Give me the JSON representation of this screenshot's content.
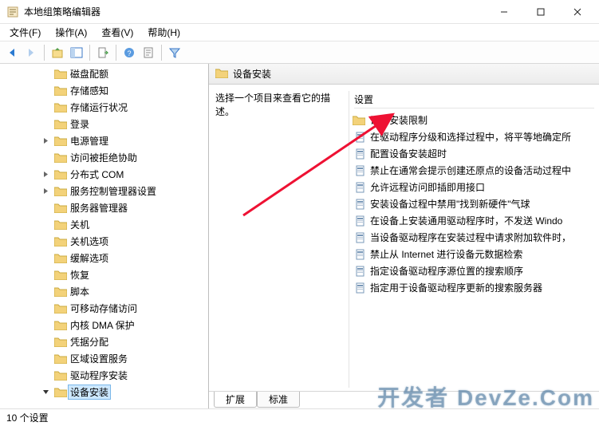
{
  "window": {
    "title": "本地组策略编辑器"
  },
  "menus": [
    "文件(F)",
    "操作(A)",
    "查看(V)",
    "帮助(H)"
  ],
  "tree_items": [
    {
      "label": "磁盘配额",
      "expandable": false
    },
    {
      "label": "存储感知",
      "expandable": false
    },
    {
      "label": "存储运行状况",
      "expandable": false
    },
    {
      "label": "登录",
      "expandable": false
    },
    {
      "label": "电源管理",
      "expandable": true
    },
    {
      "label": "访问被拒绝协助",
      "expandable": false
    },
    {
      "label": "分布式 COM",
      "expandable": true
    },
    {
      "label": "服务控制管理器设置",
      "expandable": true
    },
    {
      "label": "服务器管理器",
      "expandable": false
    },
    {
      "label": "关机",
      "expandable": false
    },
    {
      "label": "关机选项",
      "expandable": false
    },
    {
      "label": "缓解选项",
      "expandable": false
    },
    {
      "label": "恢复",
      "expandable": false
    },
    {
      "label": "脚本",
      "expandable": false
    },
    {
      "label": "可移动存储访问",
      "expandable": false
    },
    {
      "label": "内核 DMA 保护",
      "expandable": false
    },
    {
      "label": "凭据分配",
      "expandable": false
    },
    {
      "label": "区域设置服务",
      "expandable": false
    },
    {
      "label": "驱动程序安装",
      "expandable": false
    },
    {
      "label": "设备安装",
      "expandable": true,
      "selected": true
    }
  ],
  "right": {
    "header": "设备安装",
    "description_col_title": "选择一个项目来查看它的描述。",
    "settings_header": "设置",
    "settings": [
      {
        "type": "folder",
        "label": "设备安装限制"
      },
      {
        "type": "policy",
        "label": "在驱动程序分级和选择过程中，将平等地确定所"
      },
      {
        "type": "policy",
        "label": "配置设备安装超时"
      },
      {
        "type": "policy",
        "label": "禁止在通常会提示创建还原点的设备活动过程中"
      },
      {
        "type": "policy",
        "label": "允许远程访问即插即用接口"
      },
      {
        "type": "policy",
        "label": "安装设备过程中禁用\"找到新硬件\"气球"
      },
      {
        "type": "policy",
        "label": "在设备上安装通用驱动程序时，不发送 Windo"
      },
      {
        "type": "policy",
        "label": "当设备驱动程序在安装过程中请求附加软件时，"
      },
      {
        "type": "policy",
        "label": "禁止从 Internet 进行设备元数据检索"
      },
      {
        "type": "policy",
        "label": "指定设备驱动程序源位置的搜索顺序"
      },
      {
        "type": "policy",
        "label": "指定用于设备驱动程序更新的搜索服务器"
      }
    ],
    "tabs": [
      "扩展",
      "标准"
    ]
  },
  "status": "10 个设置",
  "watermark": "开发者 DevZe.Com"
}
